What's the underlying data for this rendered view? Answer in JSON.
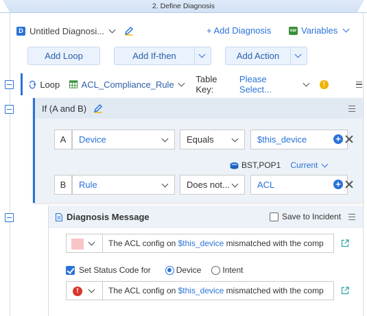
{
  "step": {
    "title": "2. Define Diagnosis"
  },
  "toolbar": {
    "diagnosis_name": "Untitled Diagnosi...",
    "add_diagnosis": "+ Add Diagnosis",
    "variables": "Variables",
    "var_badge": "var",
    "d_badge": "D"
  },
  "actions": {
    "add_loop": "Add Loop",
    "add_if_then": "Add If-then",
    "add_action": "Add Action"
  },
  "loop": {
    "label": "Loop",
    "table": "ACL_Compliance_Rule",
    "table_key_label": "Table Key:",
    "table_key_value": "Please Select..."
  },
  "if_block": {
    "title": "If (A and B)",
    "conditions": [
      {
        "letter": "A",
        "field": "Device",
        "operator": "Equals",
        "value": "$this_device"
      },
      {
        "letter": "B",
        "field": "Rule",
        "operator": "Does not...",
        "value": "ACL"
      }
    ],
    "device_ref": "BST,POP1",
    "device_scope": "Current"
  },
  "message": {
    "title": "Diagnosis Message",
    "save_to_incident": "Save to Incident",
    "text_prefix": "The ACL config on ",
    "text_var": "$this_device",
    "text_suffix": " mismatched with the comp",
    "status_code_label": "Set Status Code for",
    "radio_device": "Device",
    "radio_intent": "Intent",
    "warn_glyph": "!",
    "err_glyph": "!"
  },
  "colors": {
    "accent": "#2a72d8",
    "swatch": "#f8c4c6",
    "error": "#d9372b",
    "warning": "#f0b400"
  }
}
